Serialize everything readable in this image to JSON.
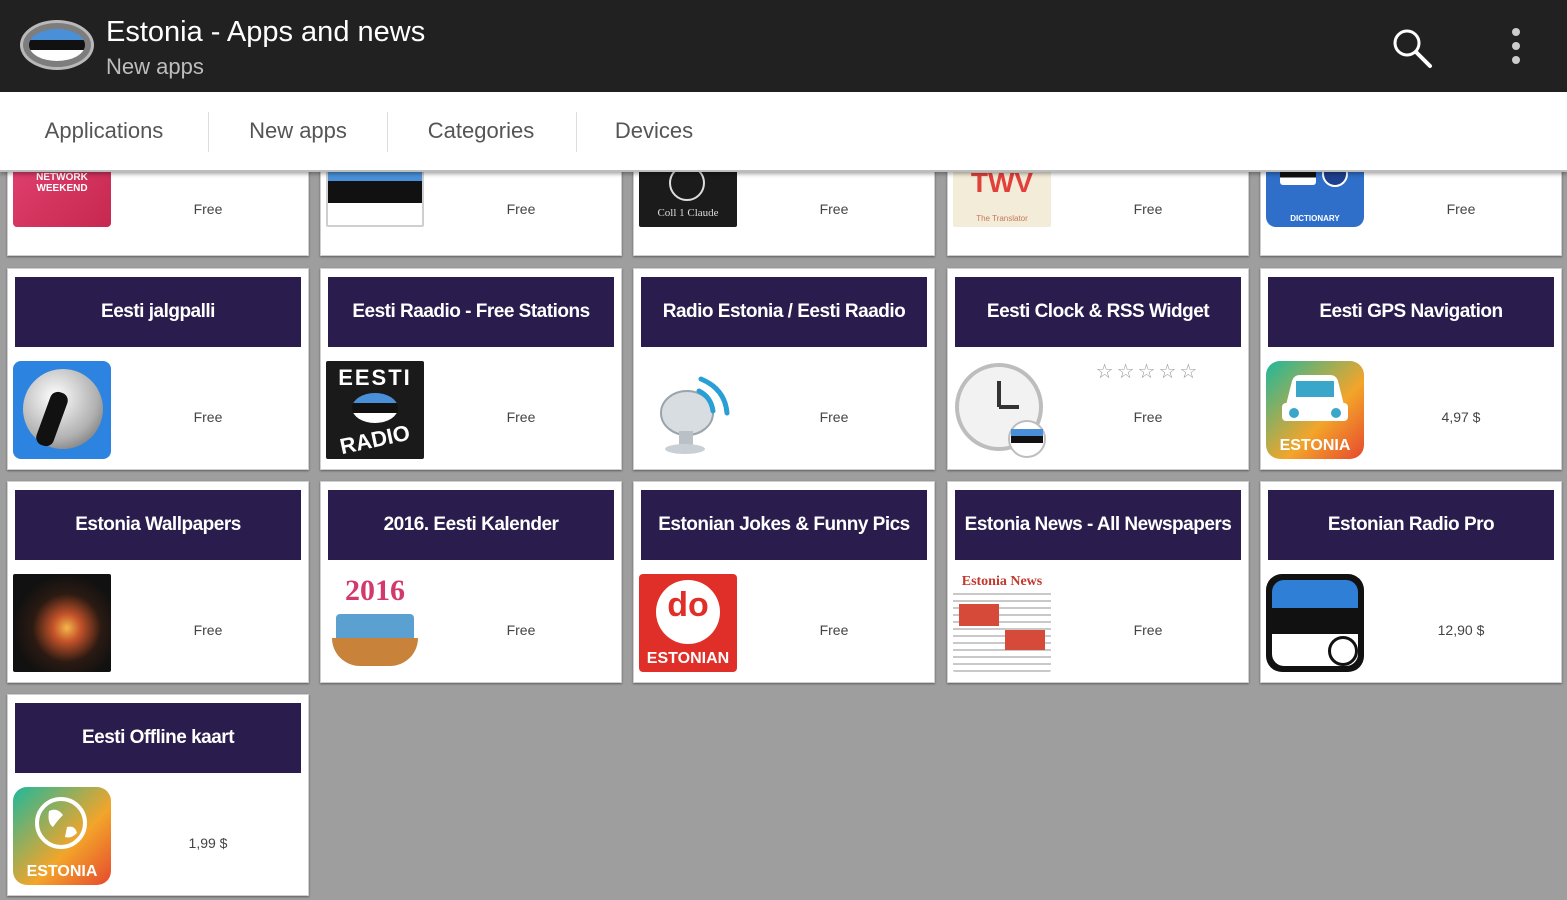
{
  "header": {
    "title": "Estonia - Apps and news",
    "subtitle": "New apps",
    "search_icon": "search-icon",
    "more_icon": "overflow-menu-icon"
  },
  "tabs": [
    "Applications",
    "New apps",
    "Categories",
    "Devices"
  ],
  "top_row_prices": [
    "Free",
    "Free",
    "Free",
    "Free",
    "Free"
  ],
  "top_row_icon_text": {
    "baltic": "BALTIC AUDIO NETWORK WEEKEND",
    "coll": "Coll 1 Claude",
    "twv": "TWV",
    "twv_sub": "The Translator",
    "dictionary": "DICTIONARY"
  },
  "apps": [
    {
      "title": "Eesti jalgpalli",
      "price": "Free"
    },
    {
      "title": "Eesti Raadio - Free Stations",
      "price": "Free",
      "icon_text_top": "EESTI",
      "icon_text_bottom": "RADIO"
    },
    {
      "title": "Radio Estonia / Eesti Raadio",
      "price": "Free"
    },
    {
      "title": "Eesti Clock & RSS Widget",
      "price": "Free",
      "rating": "☆☆☆☆☆"
    },
    {
      "title": "Eesti GPS Navigation",
      "price": "4,97 $",
      "icon_label": "ESTONIA"
    },
    {
      "title": "Estonia Wallpapers",
      "price": "Free"
    },
    {
      "title": "2016. Eesti Kalender",
      "price": "Free",
      "icon_text": "2016"
    },
    {
      "title": "Estonian Jokes & Funny Pics",
      "price": "Free",
      "icon_label": "ESTONIAN",
      "icon_text": "do"
    },
    {
      "title": "Estonia News - All Newspapers",
      "price": "Free",
      "icon_text": "Estonia News"
    },
    {
      "title": "Estonian Radio Pro",
      "price": "12,90 $"
    },
    {
      "title": "Eesti Offline kaart",
      "price": "1,99 $",
      "icon_label": "ESTONIA"
    }
  ],
  "colors": {
    "actionbar": "#212121",
    "card_title_bg": "#2a1d4e",
    "estonia_blue": "#1f6fd1",
    "background": "#9e9e9e"
  }
}
